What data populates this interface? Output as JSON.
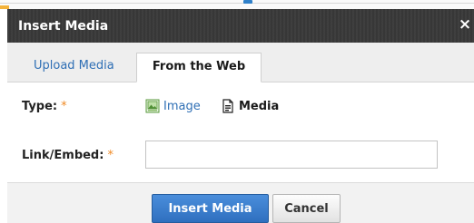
{
  "dialog": {
    "title": "Insert Media",
    "close_glyph": "×",
    "icons": {
      "close": "close-icon",
      "image_option": "image-icon",
      "media_option": "media-file-icon"
    },
    "colors": {
      "titlebar": "#3a3a3a",
      "link": "#2f6fb5",
      "required_mark": "#f08a24",
      "primary_button": "#3a7fd0"
    }
  },
  "tabs": [
    {
      "label": "Upload Media",
      "active": false
    },
    {
      "label": "From the Web",
      "active": true
    }
  ],
  "form": {
    "type_label": "Type:",
    "required_mark": "*",
    "type_options": [
      {
        "label": "Image",
        "icon": "image-icon",
        "style": "link"
      },
      {
        "label": "Media",
        "icon": "media-file-icon",
        "style": "bold",
        "selected": true
      }
    ],
    "link_label": "Link/Embed:",
    "link_value": "",
    "link_placeholder": ""
  },
  "buttons": {
    "insert": "Insert Media",
    "cancel": "Cancel"
  }
}
